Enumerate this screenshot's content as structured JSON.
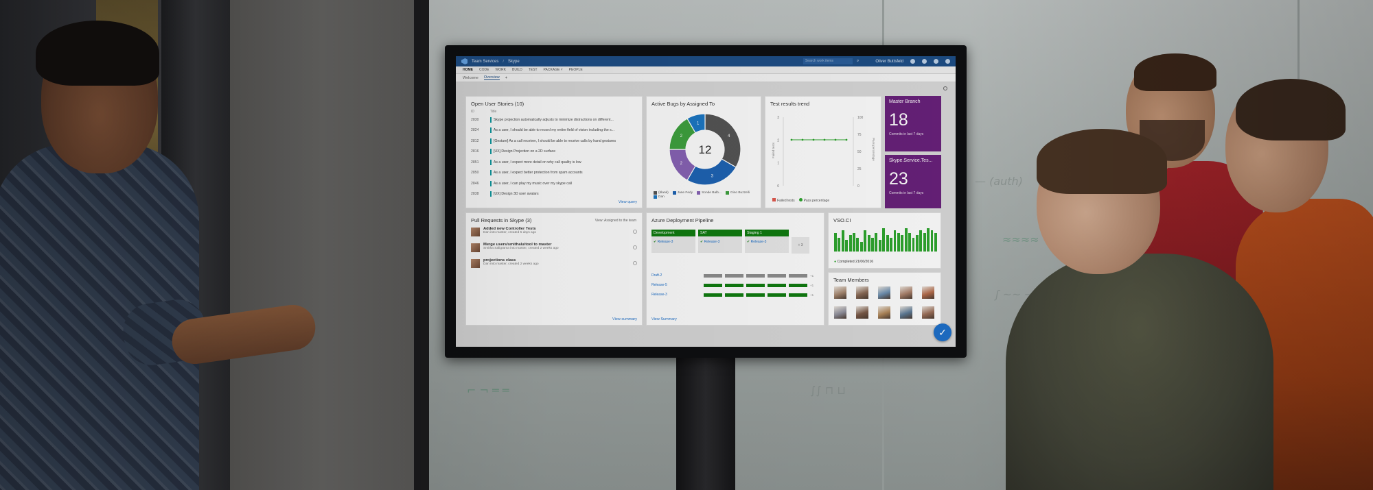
{
  "topbar": {
    "brand": "Team Services",
    "project": "Skype",
    "search": "Search work items",
    "user": "Oliver Buttsfeld"
  },
  "hubs": [
    "HOME",
    "CODE",
    "WORK",
    "BUILD",
    "TEST",
    "PACKAGE ˅",
    "PEOPLE"
  ],
  "subtabs": {
    "tab1": "Welcome",
    "tab2": "Overview",
    "add": "+"
  },
  "stories": {
    "title": "Open User Stories (10)",
    "col_id": "ID",
    "col_title": "Title",
    "rows": [
      {
        "id": "2830",
        "title": "Skype projection automatically adjusts to minimize distractions on different..."
      },
      {
        "id": "2824",
        "title": "As a user, I should be able to record my entire field of vision including the s..."
      },
      {
        "id": "2812",
        "title": "[Gesture] As a call receiver, I should be able to receive calls by hand gestures"
      },
      {
        "id": "2816",
        "title": "[UX] Design Projection on a 2D surface"
      },
      {
        "id": "2851",
        "title": "As a user, I expect more detail on why call quality is low"
      },
      {
        "id": "2850",
        "title": "As a user, I expect better protection from spam accounts"
      },
      {
        "id": "2846",
        "title": "As a user, I can play my music over my skype call"
      },
      {
        "id": "2838",
        "title": "[UX] Design 3D user avatars"
      }
    ],
    "link": "View query"
  },
  "bugs": {
    "title": "Active Bugs by Assigned To",
    "total": "12",
    "slices": [
      {
        "label": "4",
        "value": 4,
        "color": "#555555"
      },
      {
        "label": "3",
        "value": 3,
        "color": "#1e64b4"
      },
      {
        "label": "2",
        "value": 2,
        "color": "#8763b5"
      },
      {
        "label": "2",
        "value": 2,
        "color": "#3ea13e"
      },
      {
        "label": "1",
        "value": 1,
        "color": "#1c77c3"
      }
    ],
    "legend": [
      {
        "name": "(blank)",
        "color": "#555555"
      },
      {
        "name": "Jane Fedy",
        "color": "#1e64b4"
      },
      {
        "name": "Sonde Balb...",
        "color": "#8763b5"
      },
      {
        "name": "Gino Buzzelli",
        "color": "#3ea13e"
      },
      {
        "name": "Dan",
        "color": "#1c77c3"
      }
    ]
  },
  "tests": {
    "title": "Test results trend",
    "left_ticks": [
      "3",
      "2",
      "1",
      "0"
    ],
    "right_ticks": [
      "100",
      "75",
      "50",
      "25",
      "0"
    ],
    "left_label": "Failed tests",
    "right_label": "Pass percentage",
    "legend_failed": "Failed tests",
    "legend_pass": "Pass percentage",
    "failed_color": "#e05a4f",
    "pass_color": "#2ea52e"
  },
  "master": {
    "title": "Master Branch",
    "count": "18",
    "sub": "Commits in last 7 days"
  },
  "skype_svc": {
    "title": "Skype.Service.Tes...",
    "count": "23",
    "sub": "Commits in last 7 days"
  },
  "prs": {
    "title": "Pull Requests in Skype (3)",
    "view_label": "View: Assigned to the team",
    "rows": [
      {
        "title": "Added new Controller Tests",
        "sub": "Dan into master, created 5 days ago"
      },
      {
        "title": "Merge users/smithalu/tool to master",
        "sub": "Smitha Saligrama into master, created 2 weeks ago"
      },
      {
        "title": "projections class",
        "sub": "Dan into master, created 2 weeks ago"
      }
    ],
    "link": "View summary"
  },
  "azure": {
    "title": "Azure Deployment Pipeline",
    "stages": [
      {
        "name": "Development",
        "release": "Release-3"
      },
      {
        "name": "SAT",
        "release": "Release-3"
      },
      {
        "name": "Staging 1",
        "release": "Release-3"
      }
    ],
    "more_stages": "+ 3",
    "releases": [
      "Draft-2",
      "Release-5",
      "Release-3"
    ],
    "release_more": "+1",
    "link": "View Summary"
  },
  "ci": {
    "title": "VSO.CI",
    "completed": "Completed 21/06/2016",
    "bars": [
      8,
      6,
      9,
      5,
      7,
      8,
      6,
      4,
      9,
      7,
      6,
      8,
      5,
      10,
      7,
      6,
      9,
      8,
      7,
      10,
      8,
      6,
      7,
      9,
      8,
      10,
      9,
      8
    ]
  },
  "team": {
    "title": "Team Members"
  },
  "fab_icon": "check-icon"
}
